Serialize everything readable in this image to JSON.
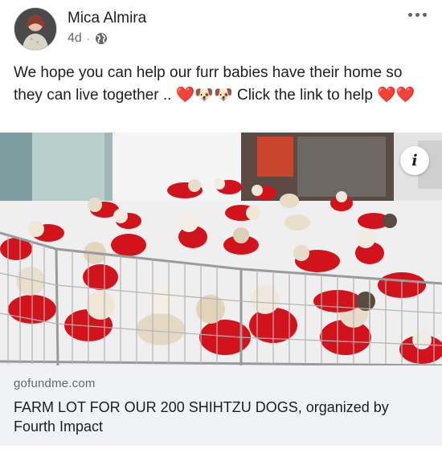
{
  "post": {
    "author": "Mica Almira",
    "time": "4d",
    "separator": "·",
    "privacy_icon": "globe-icon",
    "more_icon": "more-horizontal-icon",
    "text": "We hope you can help our furr babies have their  home so they can live together .. ❤️🐶🐶 Click the link to help ❤️❤️"
  },
  "image": {
    "info_label": "i",
    "subject": "Shih Tzu dogs wearing red clothes behind a metal fence",
    "colors": {
      "floor": "#f2f2f2",
      "wall": "#ffffff",
      "clothing": "#d3131b",
      "fence": "#9a9a9a"
    }
  },
  "link": {
    "domain": "gofundme.com",
    "title": "FARM LOT FOR OUR 200 SHIHTZU DOGS, organized by Fourth Impact"
  }
}
